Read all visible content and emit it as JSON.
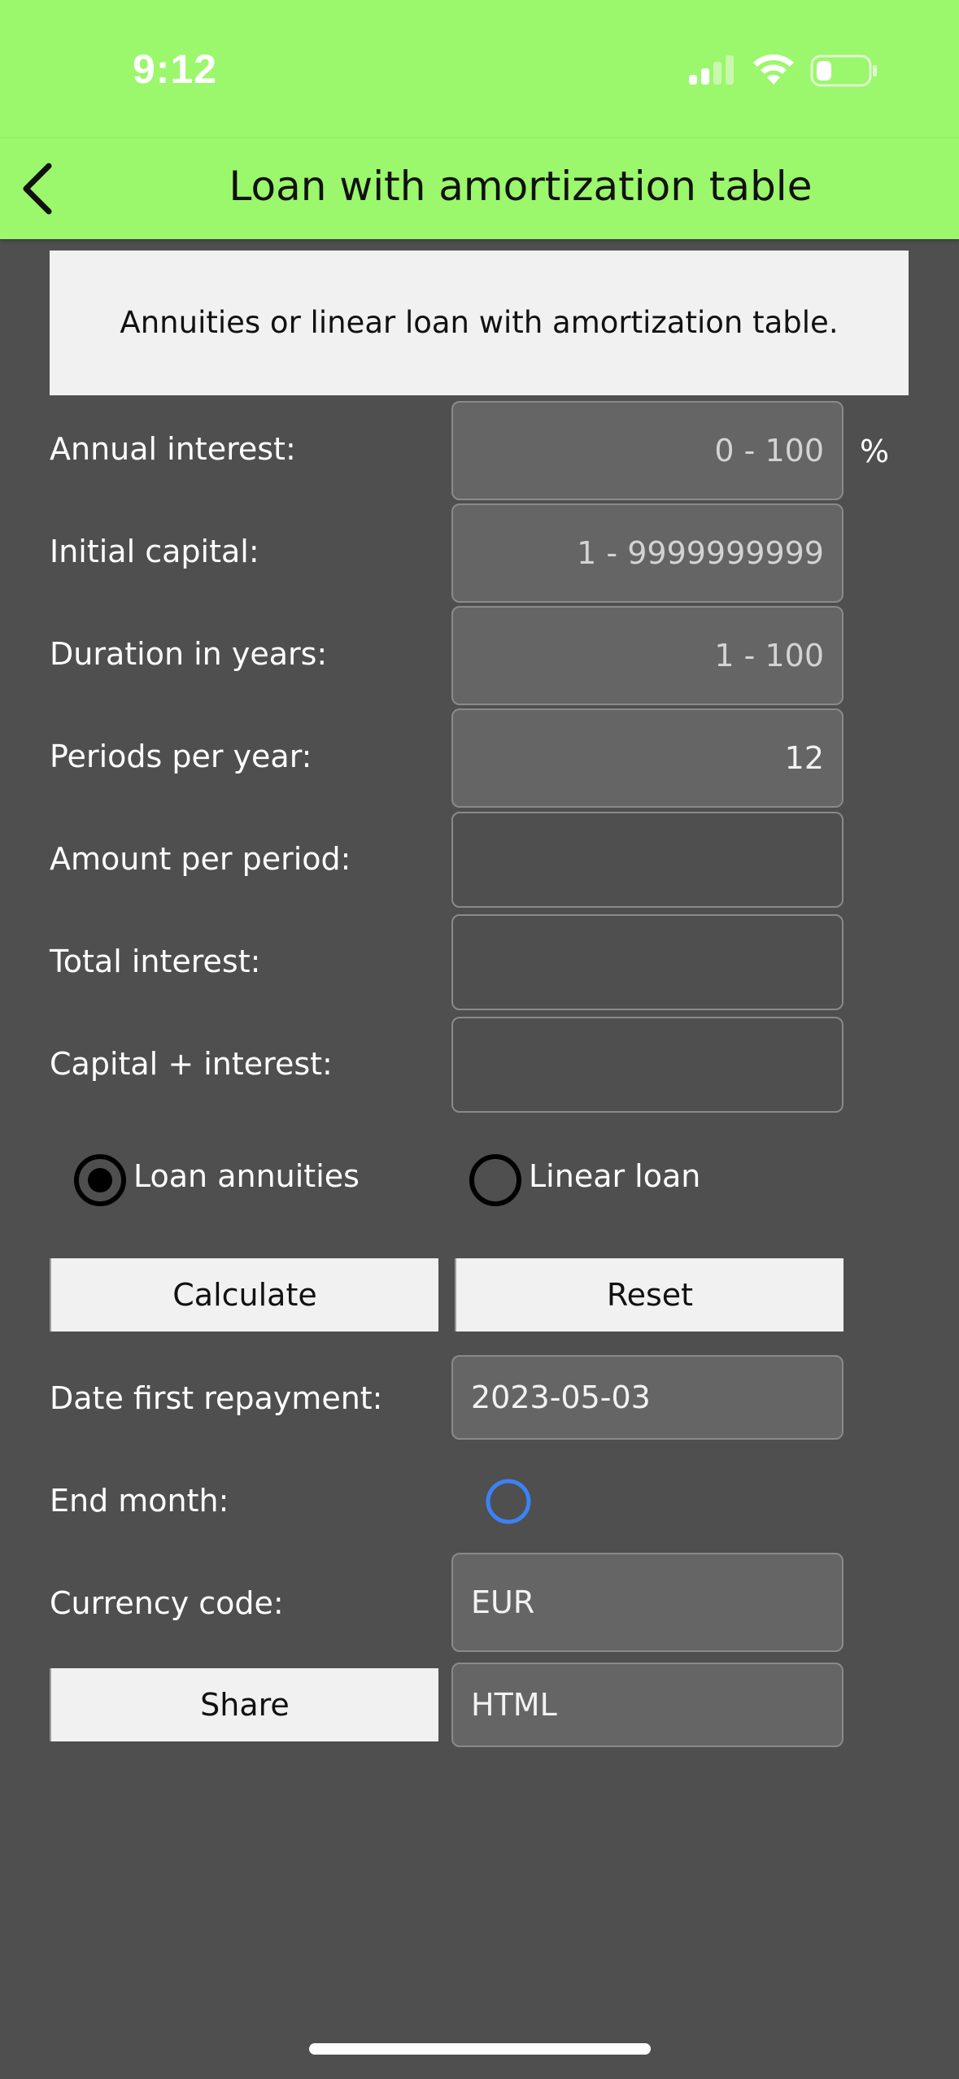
{
  "status_bar": {
    "time": "9:12",
    "signal_icon": "cellular-signal-icon",
    "wifi_icon": "wifi-icon",
    "battery_icon": "battery-low-icon",
    "background_color": "#9bf76b"
  },
  "nav": {
    "back_icon": "chevron-left-icon",
    "title": "Loan with amortization table"
  },
  "banner": {
    "text": "Annuities or linear loan with amortization table."
  },
  "form": {
    "annual_interest": {
      "label": "Annual interest:",
      "placeholder": "0 - 100",
      "unit": "%"
    },
    "initial_capital": {
      "label": "Initial capital:",
      "placeholder": "1 - 9999999999"
    },
    "duration": {
      "label": "Duration in years:",
      "placeholder": "1 - 100"
    },
    "periods": {
      "label": "Periods per year:",
      "value": "12"
    },
    "amount_per_period": {
      "label": "Amount per period:",
      "value": ""
    },
    "total_interest": {
      "label": "Total interest:",
      "value": ""
    },
    "capital_interest": {
      "label": "Capital + interest:",
      "value": ""
    }
  },
  "loan_type": {
    "options": [
      {
        "label": "Loan annuities",
        "selected": true
      },
      {
        "label": "Linear loan",
        "selected": false
      }
    ]
  },
  "buttons": {
    "calculate": "Calculate",
    "reset": "Reset",
    "share": "Share"
  },
  "date_first_repayment": {
    "label": "Date first repayment:",
    "value": "2023-05-03"
  },
  "end_month": {
    "label": "End month:",
    "checked": false,
    "accent_color": "#3b82f6"
  },
  "currency": {
    "label": "Currency code:",
    "value": "EUR"
  },
  "share_format": {
    "value": "HTML"
  }
}
